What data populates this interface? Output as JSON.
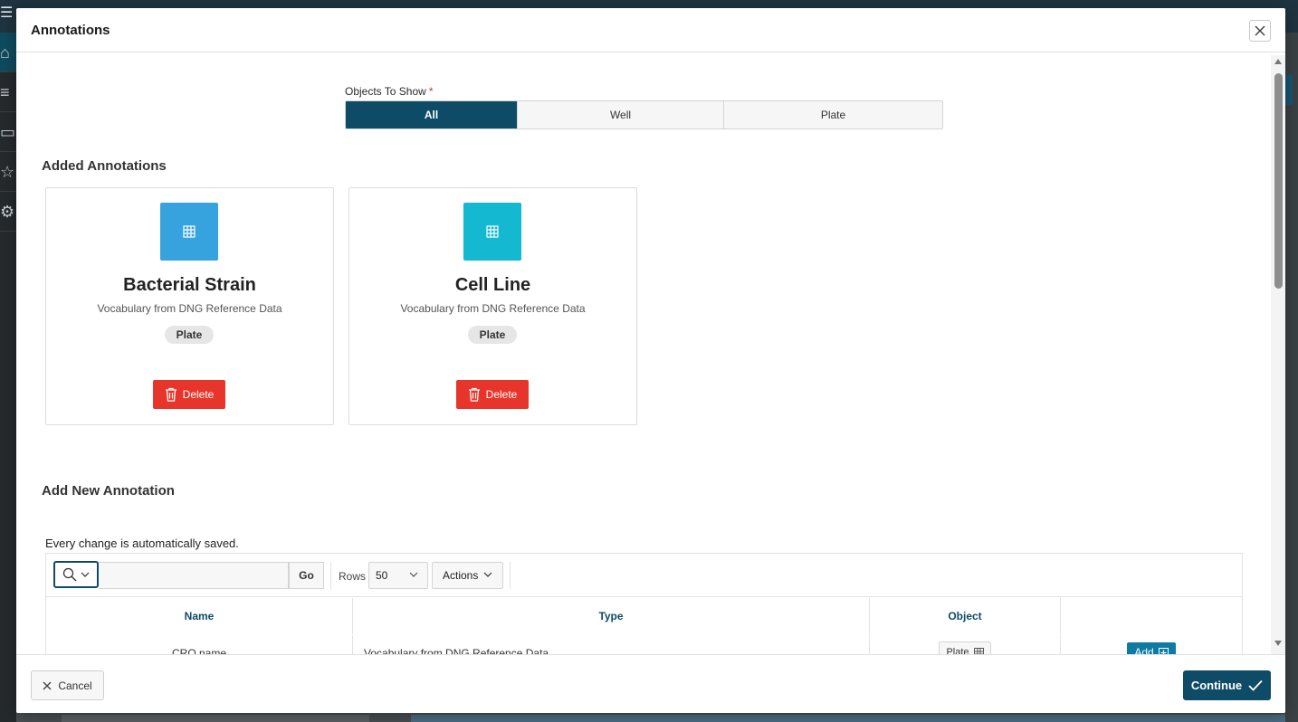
{
  "dialog": {
    "title": "Annotations",
    "close_icon": "close-icon"
  },
  "objects_filter": {
    "label": "Objects To Show",
    "required_mark": "*",
    "options": [
      "All",
      "Well",
      "Plate"
    ],
    "selected": "All"
  },
  "added_annotations": {
    "title": "Added Annotations",
    "cards": [
      {
        "title": "Bacterial Strain",
        "subtitle": "Vocabulary from DNG Reference Data",
        "badge": "Plate",
        "icon": "grid-icon",
        "icon_color": "#36a3de",
        "delete_label": "Delete"
      },
      {
        "title": "Cell Line",
        "subtitle": "Vocabulary from DNG Reference Data",
        "badge": "Plate",
        "icon": "grid-icon",
        "icon_color": "#14b8d0",
        "delete_label": "Delete"
      }
    ]
  },
  "add_new": {
    "title": "Add New Annotation",
    "autosave_note": "Every change is automatically saved.",
    "toolbar": {
      "search_value": "",
      "go_label": "Go",
      "rows_label": "Rows",
      "rows_value": "50",
      "actions_label": "Actions"
    },
    "columns": [
      "Name",
      "Type",
      "Object",
      ""
    ],
    "rows": [
      {
        "name": "CRO name",
        "type": "Vocabulary from DNG Reference Data",
        "object": "Plate",
        "action_label": "Add"
      }
    ]
  },
  "footer": {
    "cancel_label": "Cancel",
    "continue_label": "Continue"
  },
  "colors": {
    "primary": "#0e4b66",
    "danger": "#e8352b",
    "add_button": "#0e7ba3"
  }
}
